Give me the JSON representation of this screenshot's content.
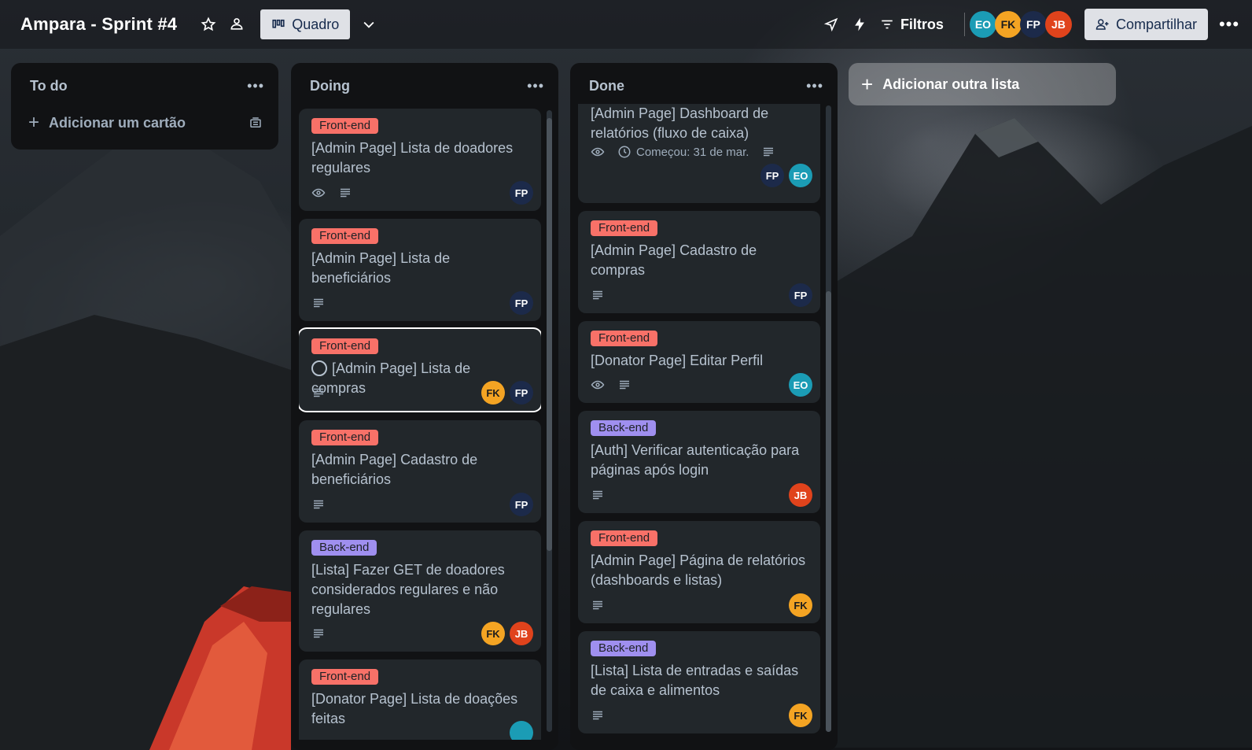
{
  "board": {
    "title": "Ampara - Sprint #4",
    "view_label": "Quadro",
    "filters_label": "Filtros",
    "share_label": "Compartilhar",
    "members": [
      "EO",
      "FK",
      "FP",
      "JB"
    ]
  },
  "colors": {
    "label_red": "#f87168",
    "label_purple": "#9f8fef",
    "card_bg": "#22272b",
    "list_bg": "#111214"
  },
  "lists": [
    {
      "title": "To do",
      "add_card_label": "Adicionar um cartão",
      "cards": []
    },
    {
      "title": "Doing",
      "cards": [
        {
          "label": "Front-end",
          "title": "[Admin Page] Lista de doadores regulares",
          "badges": [
            "eye-icon",
            "description-icon"
          ],
          "members": [
            "FP"
          ]
        },
        {
          "label": "Front-end",
          "title": "[Admin Page] Lista de beneficiários",
          "badges": [
            "description-icon"
          ],
          "members": [
            "FP"
          ]
        },
        {
          "label": "Front-end",
          "title": "[Admin Page] Lista de compras",
          "badges": [
            "description-icon"
          ],
          "members": [
            "FK",
            "FP"
          ],
          "selected": true
        },
        {
          "label": "Front-end",
          "title": "[Admin Page] Cadastro de beneficiários",
          "badges": [
            "description-icon"
          ],
          "members": [
            "FP"
          ]
        },
        {
          "label": "Back-end",
          "title": "[Lista] Fazer GET de doadores considerados regulares e não regulares",
          "badges": [
            "description-icon"
          ],
          "members": [
            "FK",
            "JB"
          ]
        },
        {
          "label": "Front-end",
          "title": "[Donator Page] Lista de doações feitas",
          "badges": [],
          "members": []
        }
      ]
    },
    {
      "title": "Done",
      "cards": [
        {
          "label": "",
          "title": "[Admin Page] Dashboard de relatórios (fluxo de caixa)",
          "date": "Começou: 31 de mar.",
          "members": [
            "FP",
            "EO"
          ]
        },
        {
          "label": "Front-end",
          "title": "[Admin Page] Cadastro de compras",
          "members": [
            "FP"
          ]
        },
        {
          "label": "Front-end",
          "title": "[Donator Page] Editar Perfil",
          "members": [
            "EO"
          ]
        },
        {
          "label": "Back-end",
          "title": "[Auth] Verificar autenticação para páginas após login",
          "members": [
            "JB"
          ]
        },
        {
          "label": "Front-end",
          "title": "[Admin Page] Página de relatórios (dashboards e listas)",
          "members": [
            "FK"
          ]
        },
        {
          "label": "Back-end",
          "title": "[Lista] Lista de entradas e saídas de caixa e alimentos",
          "members": [
            "FK"
          ]
        }
      ]
    }
  ],
  "add_list_label": "Adicionar outra lista"
}
